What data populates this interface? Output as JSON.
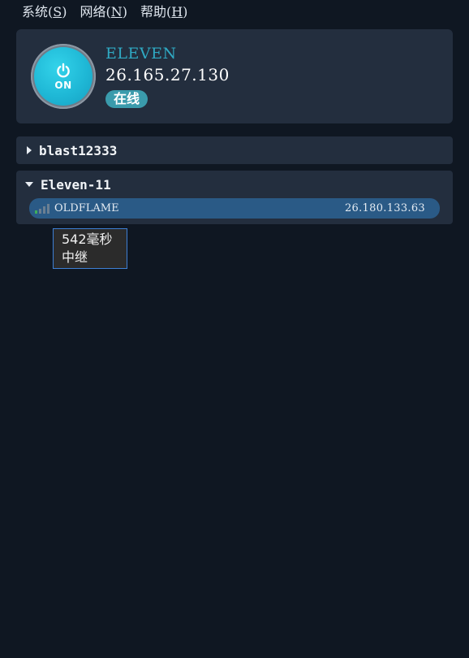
{
  "menu": [
    {
      "label": "系统(",
      "mnemonic": "S",
      "suffix": ")"
    },
    {
      "label": "网络(",
      "mnemonic": "N",
      "suffix": ")"
    },
    {
      "label": "帮助(",
      "mnemonic": "H",
      "suffix": ")"
    }
  ],
  "status": {
    "power_label": "ON",
    "device_name": "ELEVEN",
    "ip": "26.165.27.130",
    "state_label": "在线",
    "accent_color": "#2fa9c3",
    "power_color": "#1fb8d6"
  },
  "groups": [
    {
      "name": "blast12333",
      "expanded": false
    },
    {
      "name": "Eleven-11",
      "expanded": true,
      "peers": [
        {
          "name": "OLDFLAME",
          "ip": "26.180.133.63",
          "signal_bars_active": 1,
          "signal_bars_total": 4
        }
      ]
    }
  ],
  "tooltip": {
    "latency": "542毫秒",
    "route": "中继"
  }
}
